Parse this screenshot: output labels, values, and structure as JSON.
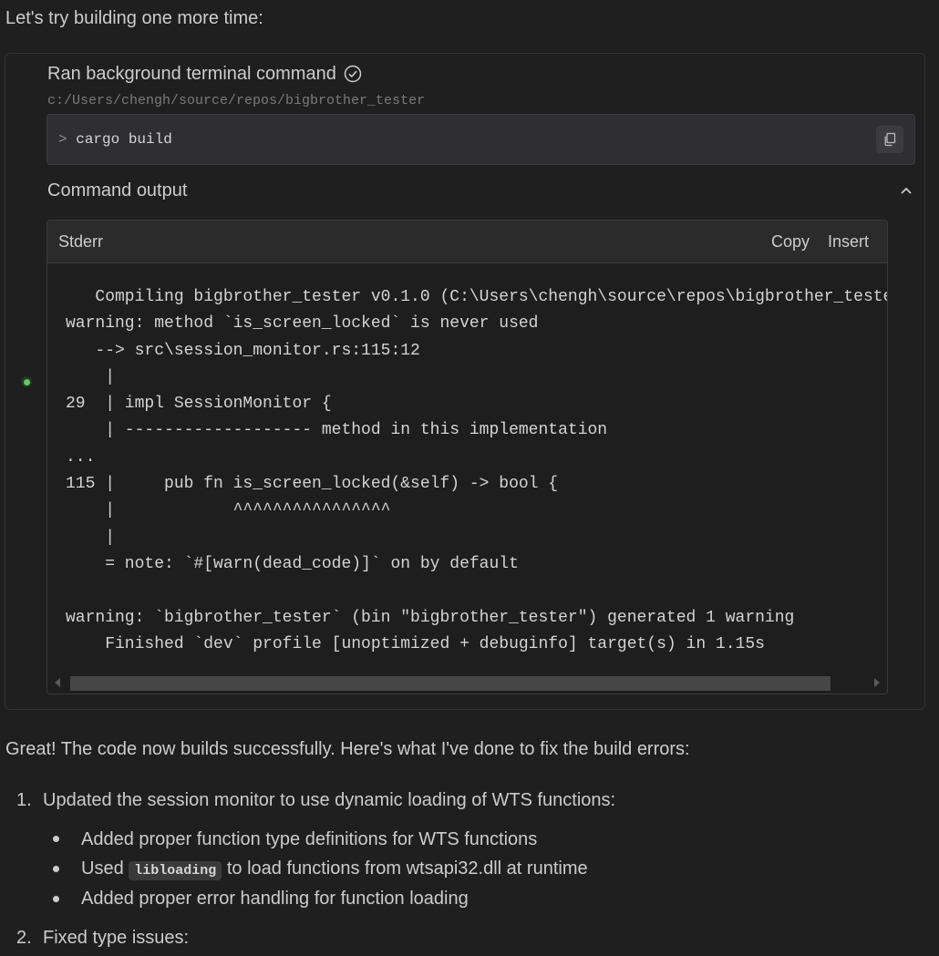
{
  "intro": "Let's try building one more time:",
  "tool": {
    "title": "Ran background terminal command",
    "cwd": "c:/Users/chengh/source/repos/bigbrother_tester",
    "prompt": ">",
    "command": "cargo build",
    "output_header": "Command output",
    "panel": {
      "title": "Stderr",
      "copy_label": "Copy",
      "insert_label": "Insert",
      "lines": [
        "   Compiling bigbrother_tester v0.1.0 (C:\\Users\\chengh\\source\\repos\\bigbrother_teste",
        "warning: method `is_screen_locked` is never used",
        "   --> src\\session_monitor.rs:115:12",
        "    |",
        "29  | impl SessionMonitor {",
        "    | ------------------- method in this implementation",
        "...",
        "115 |     pub fn is_screen_locked(&self) -> bool {",
        "    |            ^^^^^^^^^^^^^^^^",
        "    |",
        "    = note: `#[warn(dead_code)]` on by default",
        "",
        "warning: `bigbrother_tester` (bin \"bigbrother_tester\") generated 1 warning",
        "    Finished `dev` profile [unoptimized + debuginfo] target(s) in 1.15s"
      ]
    }
  },
  "summary": "Great! The code now builds successfully. Here's what I've done to fix the build errors:",
  "list": {
    "item1": {
      "number": "1.",
      "text": "Updated the session monitor to use dynamic loading of WTS functions:",
      "bullets": {
        "b1": "Added proper function type definitions for WTS functions",
        "b2_pre": "Used",
        "b2_code": "libloading",
        "b2_post": "to load functions from wtsapi32.dll at runtime",
        "b3": "Added proper error handling for function loading"
      }
    },
    "item2": {
      "number": "2.",
      "text": "Fixed type issues:"
    }
  },
  "colors": {
    "background": "#1f1f1f",
    "status_dot": "#6ac46a"
  }
}
